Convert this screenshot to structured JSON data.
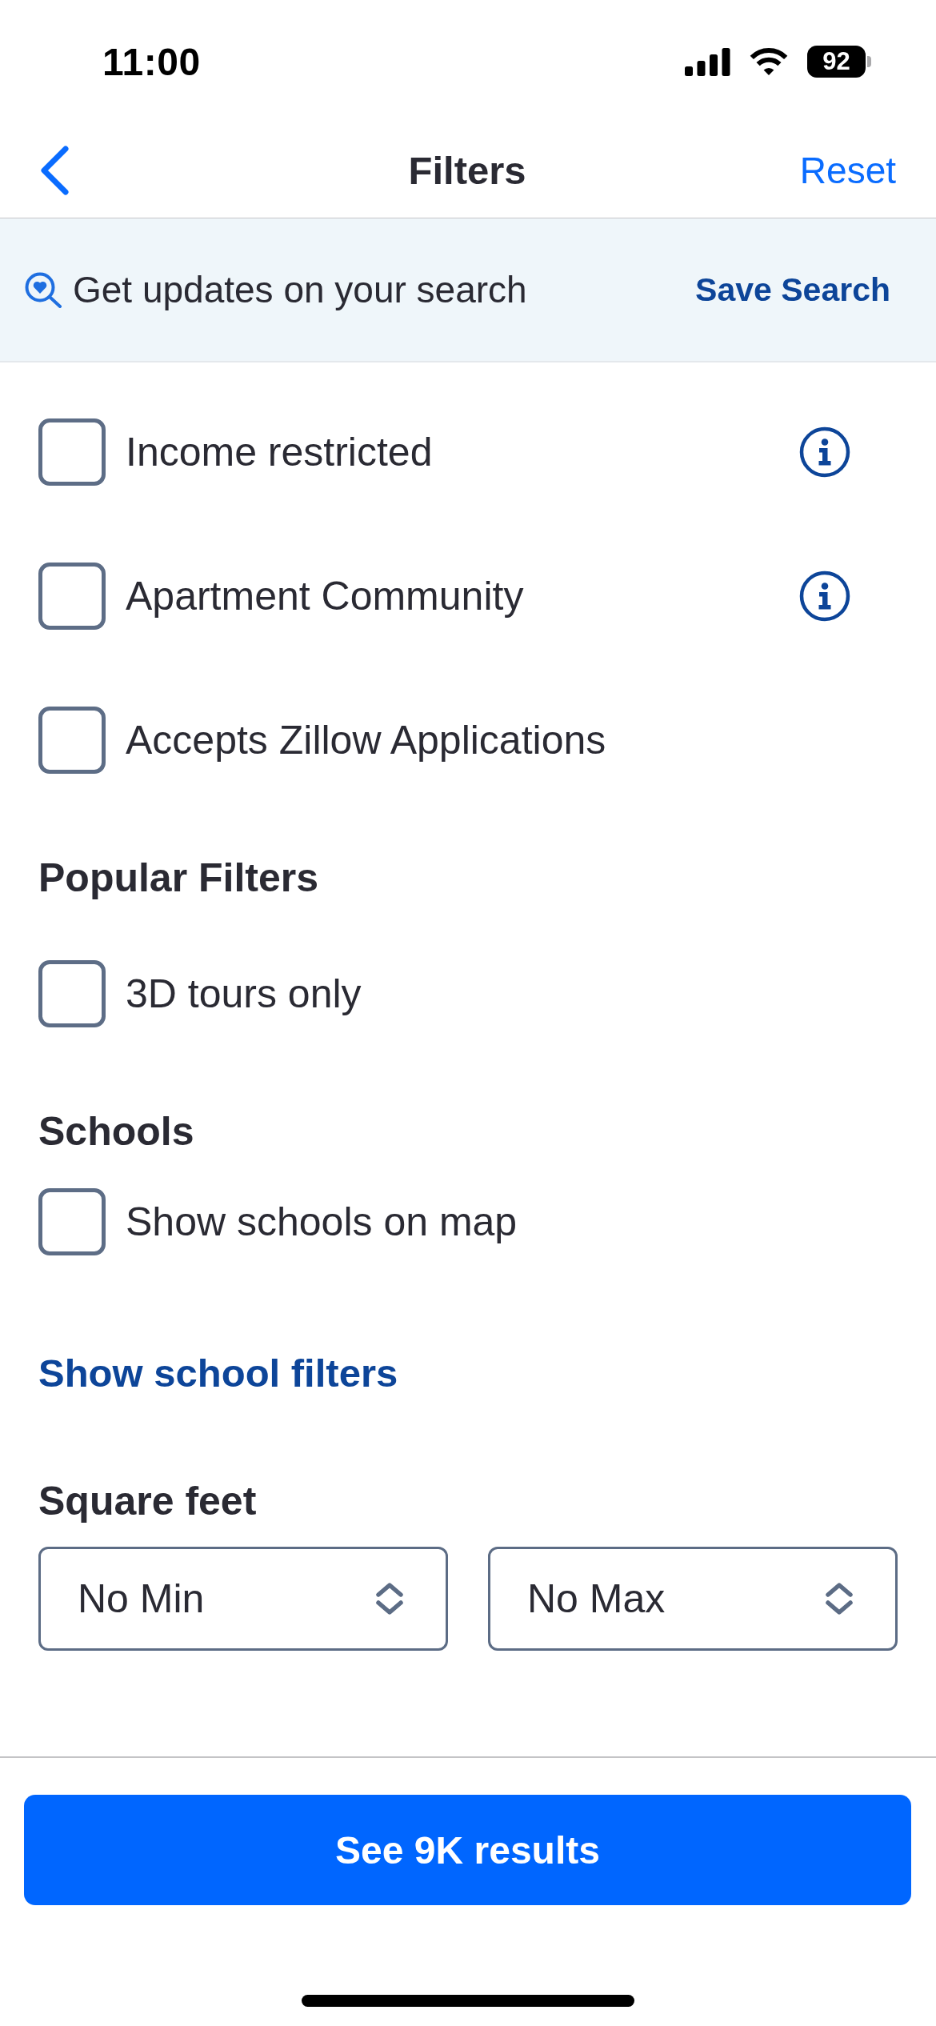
{
  "status_bar": {
    "time": "11:00",
    "battery": "92"
  },
  "nav_bar": {
    "title": "Filters",
    "action": "Reset"
  },
  "save_banner": {
    "text": "Get updates on your search",
    "action": "Save Search"
  },
  "sections": [
    {
      "kind": "checkboxes",
      "options": [
        {
          "label": "Income restricted",
          "checked": false,
          "info": true
        },
        {
          "label": "Apartment Community",
          "checked": false,
          "info": true
        },
        {
          "label": "Accepts Zillow Applications",
          "checked": false,
          "info": false
        }
      ]
    },
    {
      "kind": "checkboxes",
      "heading": "Popular Filters",
      "options": [
        {
          "label": "3D tours only",
          "checked": false,
          "info": false
        }
      ]
    },
    {
      "kind": "map_layer",
      "heading": "Schools",
      "options": [
        {
          "label": "Show schools on map",
          "checked": false,
          "info": false
        }
      ],
      "link": "Show school filters"
    },
    {
      "kind": "range",
      "heading": "Square feet",
      "min": "No Min",
      "max": "No Max"
    }
  ],
  "footer": {
    "button": "See 9K results"
  }
}
